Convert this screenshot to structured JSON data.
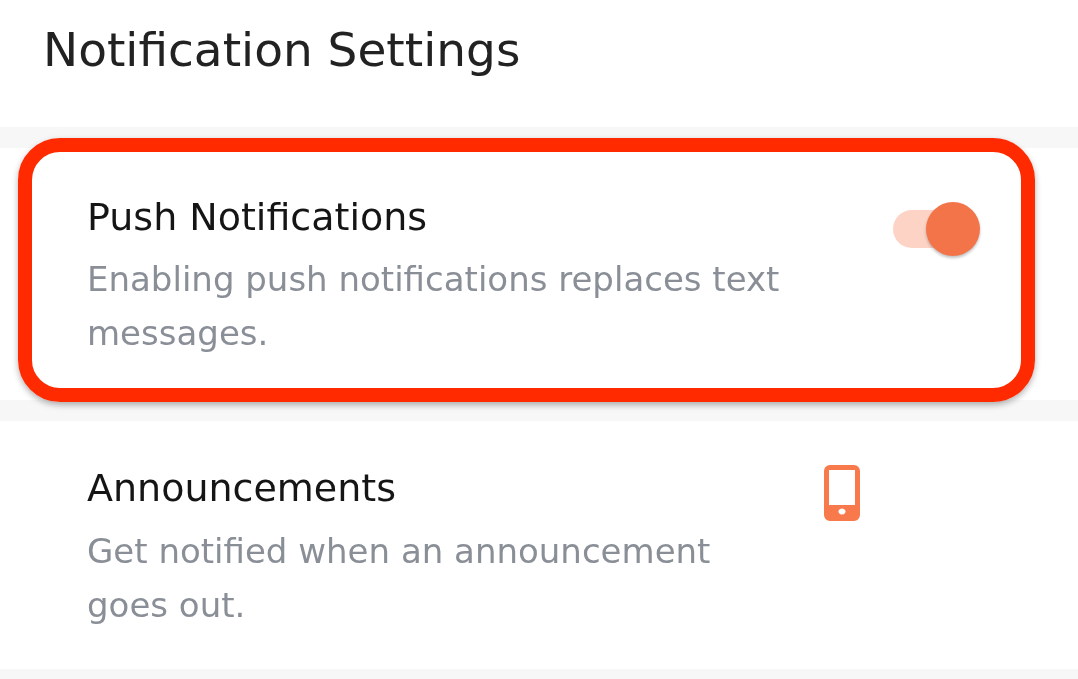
{
  "title": "Notification Settings",
  "settings": [
    {
      "kind": "toggle",
      "label": "Push Notifications",
      "description": "Enabling push notifications replaces text messages.",
      "on": true,
      "highlighted": true
    },
    {
      "kind": "channel",
      "label": "Announcements",
      "description": "Get notified when an announcement goes out.",
      "on": true
    }
  ]
}
